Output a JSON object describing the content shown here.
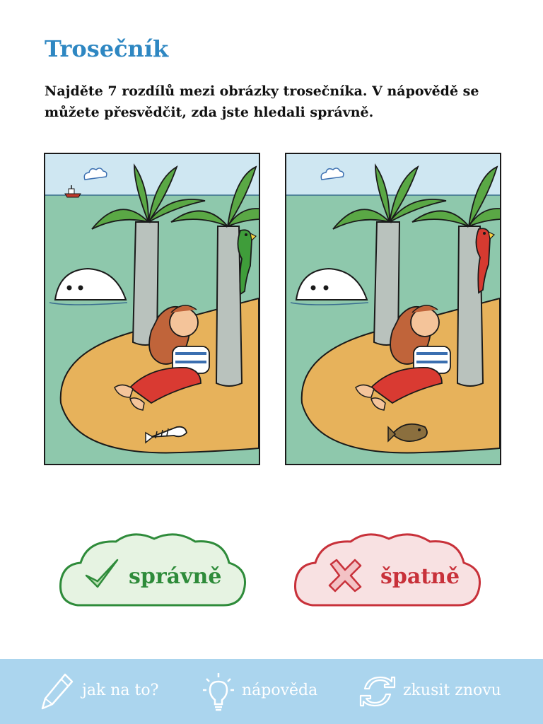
{
  "page": {
    "title": "Trosečník",
    "instructions": "Najděte 7 rozdílů mezi obrázky trosečníka. V nápovědě se můžete přesvědčit, zda jste hledali správně."
  },
  "buttons": {
    "correct_label": "správně",
    "wrong_label": "špatně"
  },
  "footer": {
    "items": [
      {
        "label": "jak na to?",
        "icon": "pencil-icon"
      },
      {
        "label": "nápověda",
        "icon": "lightbulb-icon"
      },
      {
        "label": "zkusit znovu",
        "icon": "refresh-icon"
      }
    ]
  },
  "colors": {
    "title": "#2e87c2",
    "correct": "#2e8b3a",
    "wrong": "#c8313a",
    "footer_bg": "#abd5ee"
  }
}
